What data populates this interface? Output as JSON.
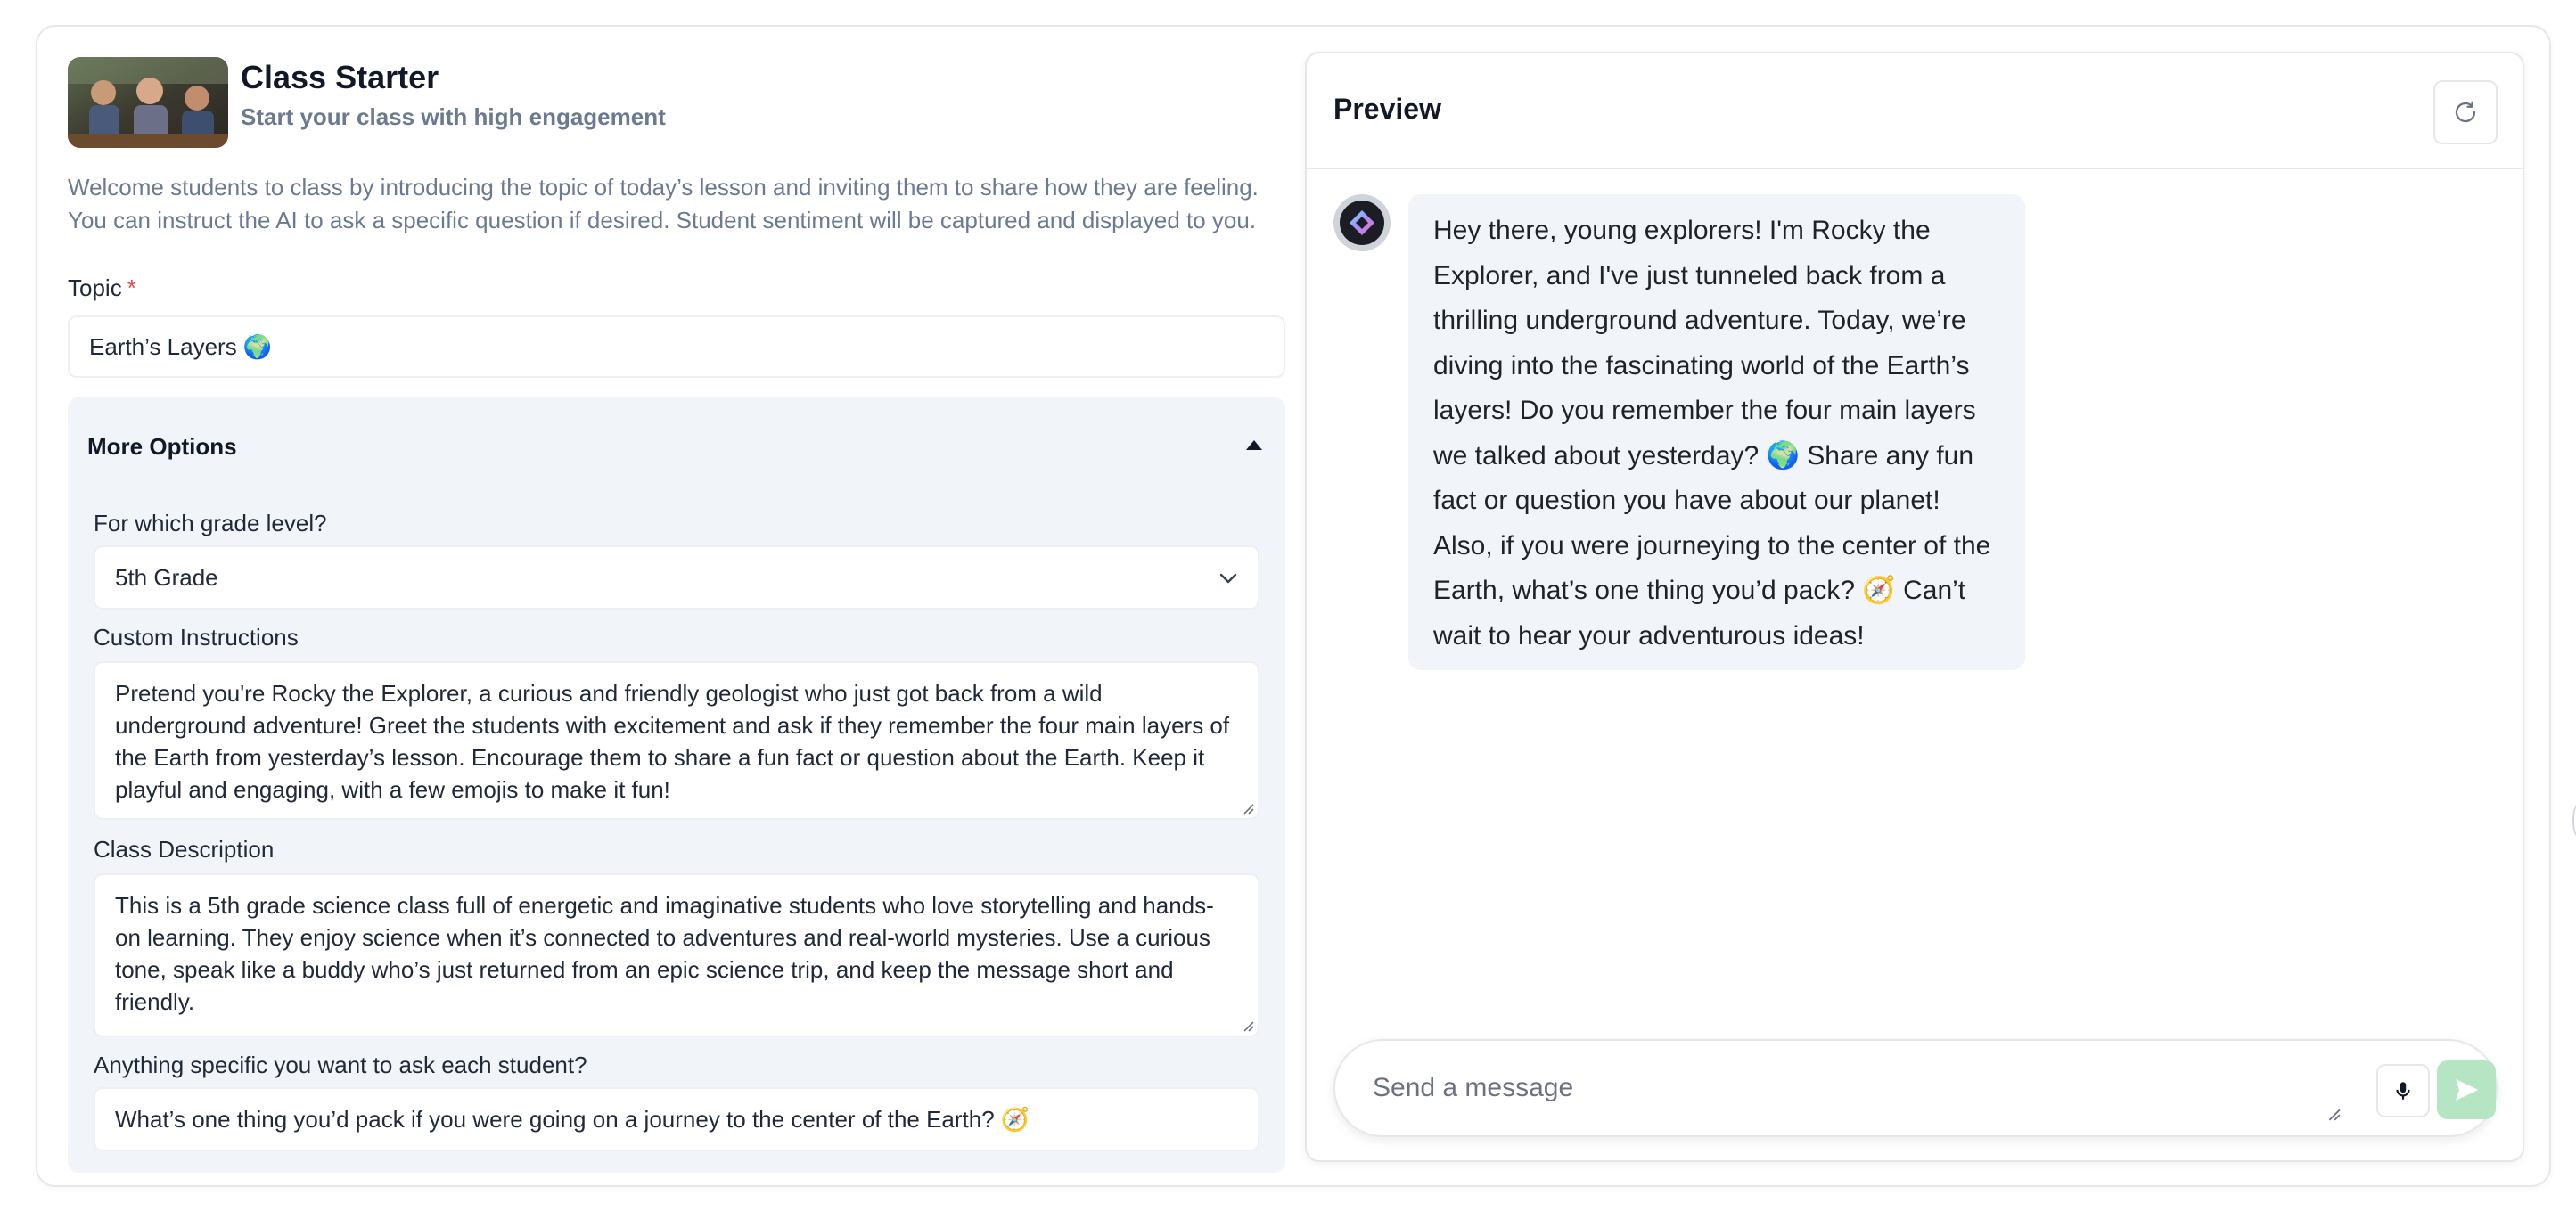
{
  "app": {
    "title": "Class Starter",
    "subtitle": "Start your class with high engagement",
    "description": "Welcome students to class by introducing the topic of today’s lesson and inviting them to share how they are feeling. You can instruct the AI to ask a specific question if desired. Student sentiment will be captured and displayed to you."
  },
  "form": {
    "topic_label": "Topic",
    "required_mark": "*",
    "topic_value": "Earth’s Layers 🌍",
    "more_options_label": "More Options",
    "grade_label": "For which grade level?",
    "grade_value": "5th Grade",
    "custom_label": "Custom Instructions",
    "custom_value": "Pretend you're Rocky the Explorer, a curious and friendly geologist who just got back from a wild underground adventure! Greet the students with excitement and ask if they remember the four main layers of the Earth from yesterday’s lesson. Encourage them to share a fun fact or question about the Earth. Keep it playful and engaging, with a few emojis to make it fun!",
    "class_desc_label": "Class Description",
    "class_desc_value": "This is a 5th grade science class full of energetic and imaginative students who love storytelling and hands-on learning. They enjoy science when it’s connected to adventures and real-world mysteries. Use a curious tone, speak like a buddy who’s just returned from an epic science trip, and keep the message short and friendly.",
    "ask_label": "Anything specific you want to ask each student?",
    "ask_value": "What’s one thing you’d pack if you were going on a journey to the center of the Earth? 🧭"
  },
  "preview": {
    "title": "Preview",
    "message": "Hey there, young explorers! I'm Rocky the Explorer, and I've just tunneled back from a thrilling underground adventure. Today, we’re diving into the fascinating world of the Earth’s layers! Do you remember the four main layers we talked about yesterday? 🌍 Share any fun fact or question you have about our planet! Also, if you were journeying to the center of the Earth, what’s one thing you’d pack? 🧭 Can’t wait to hear your adventurous ideas!",
    "composer_placeholder": "Send a message"
  },
  "icons": {
    "refresh": "refresh-icon",
    "mic": "microphone-icon",
    "send": "send-icon",
    "caret": "chevron-up-icon",
    "select_chevron": "chevron-down-icon",
    "avatar": "bot-avatar-icon"
  },
  "colors": {
    "muted_text": "#6b7a90",
    "panel_bg": "#f1f4f8",
    "send_button": "#b6e5c3",
    "required": "#e5484d"
  }
}
